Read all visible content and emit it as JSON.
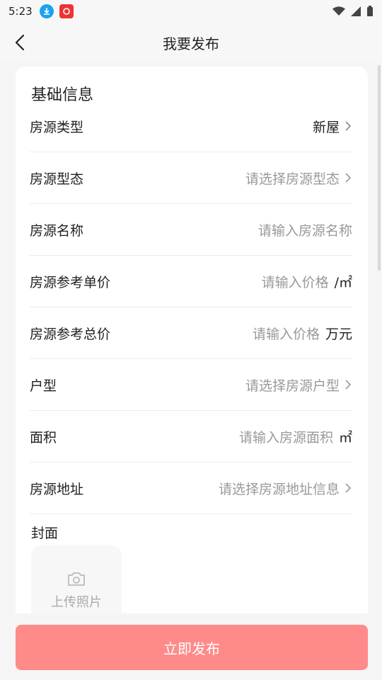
{
  "status_bar": {
    "time": "5:23"
  },
  "nav": {
    "title": "我要发布"
  },
  "form": {
    "section_title": "基础信息",
    "rows": [
      {
        "label": "房源类型",
        "value": "新屋",
        "filled": true,
        "chevron": true,
        "unit": ""
      },
      {
        "label": "房源型态",
        "value": "请选择房源型态",
        "filled": false,
        "chevron": true,
        "unit": ""
      },
      {
        "label": "房源名称",
        "value": "请输入房源名称",
        "filled": false,
        "chevron": false,
        "unit": ""
      },
      {
        "label": "房源参考单价",
        "value": "请输入价格",
        "filled": false,
        "chevron": false,
        "unit": "/㎡"
      },
      {
        "label": "房源参考总价",
        "value": "请输入价格",
        "filled": false,
        "chevron": false,
        "unit": "万元"
      },
      {
        "label": "户型",
        "value": "请选择房源户型",
        "filled": false,
        "chevron": true,
        "unit": ""
      },
      {
        "label": "面积",
        "value": "请输入房源面积",
        "filled": false,
        "chevron": false,
        "unit": "㎡"
      },
      {
        "label": "房源地址",
        "value": "请选择房源地址信息",
        "filled": false,
        "chevron": true,
        "unit": ""
      }
    ],
    "cover_title": "封面",
    "upload_label": "上传照片"
  },
  "publish_button": "立即发布"
}
